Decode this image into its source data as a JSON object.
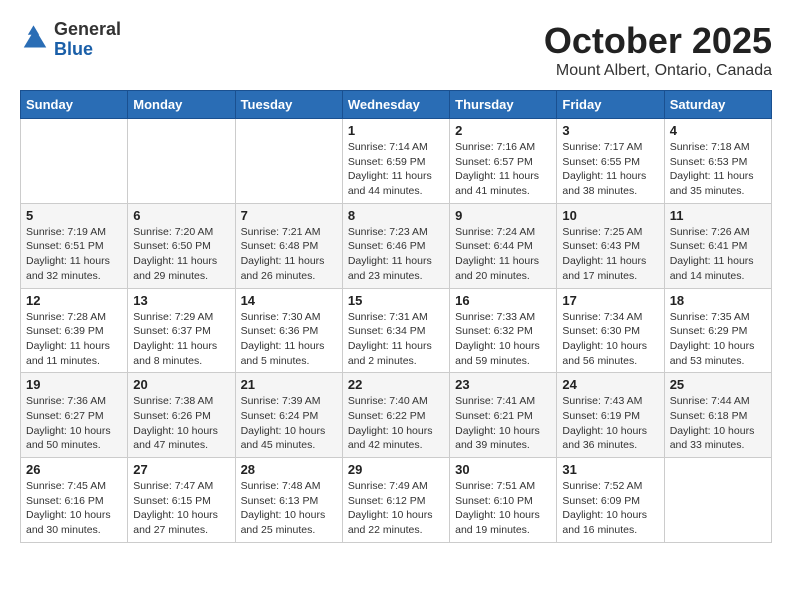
{
  "header": {
    "logo_general": "General",
    "logo_blue": "Blue",
    "month_title": "October 2025",
    "location": "Mount Albert, Ontario, Canada"
  },
  "weekdays": [
    "Sunday",
    "Monday",
    "Tuesday",
    "Wednesday",
    "Thursday",
    "Friday",
    "Saturday"
  ],
  "weeks": [
    [
      {
        "day": "",
        "info": ""
      },
      {
        "day": "",
        "info": ""
      },
      {
        "day": "",
        "info": ""
      },
      {
        "day": "1",
        "info": "Sunrise: 7:14 AM\nSunset: 6:59 PM\nDaylight: 11 hours and 44 minutes."
      },
      {
        "day": "2",
        "info": "Sunrise: 7:16 AM\nSunset: 6:57 PM\nDaylight: 11 hours and 41 minutes."
      },
      {
        "day": "3",
        "info": "Sunrise: 7:17 AM\nSunset: 6:55 PM\nDaylight: 11 hours and 38 minutes."
      },
      {
        "day": "4",
        "info": "Sunrise: 7:18 AM\nSunset: 6:53 PM\nDaylight: 11 hours and 35 minutes."
      }
    ],
    [
      {
        "day": "5",
        "info": "Sunrise: 7:19 AM\nSunset: 6:51 PM\nDaylight: 11 hours and 32 minutes."
      },
      {
        "day": "6",
        "info": "Sunrise: 7:20 AM\nSunset: 6:50 PM\nDaylight: 11 hours and 29 minutes."
      },
      {
        "day": "7",
        "info": "Sunrise: 7:21 AM\nSunset: 6:48 PM\nDaylight: 11 hours and 26 minutes."
      },
      {
        "day": "8",
        "info": "Sunrise: 7:23 AM\nSunset: 6:46 PM\nDaylight: 11 hours and 23 minutes."
      },
      {
        "day": "9",
        "info": "Sunrise: 7:24 AM\nSunset: 6:44 PM\nDaylight: 11 hours and 20 minutes."
      },
      {
        "day": "10",
        "info": "Sunrise: 7:25 AM\nSunset: 6:43 PM\nDaylight: 11 hours and 17 minutes."
      },
      {
        "day": "11",
        "info": "Sunrise: 7:26 AM\nSunset: 6:41 PM\nDaylight: 11 hours and 14 minutes."
      }
    ],
    [
      {
        "day": "12",
        "info": "Sunrise: 7:28 AM\nSunset: 6:39 PM\nDaylight: 11 hours and 11 minutes."
      },
      {
        "day": "13",
        "info": "Sunrise: 7:29 AM\nSunset: 6:37 PM\nDaylight: 11 hours and 8 minutes."
      },
      {
        "day": "14",
        "info": "Sunrise: 7:30 AM\nSunset: 6:36 PM\nDaylight: 11 hours and 5 minutes."
      },
      {
        "day": "15",
        "info": "Sunrise: 7:31 AM\nSunset: 6:34 PM\nDaylight: 11 hours and 2 minutes."
      },
      {
        "day": "16",
        "info": "Sunrise: 7:33 AM\nSunset: 6:32 PM\nDaylight: 10 hours and 59 minutes."
      },
      {
        "day": "17",
        "info": "Sunrise: 7:34 AM\nSunset: 6:30 PM\nDaylight: 10 hours and 56 minutes."
      },
      {
        "day": "18",
        "info": "Sunrise: 7:35 AM\nSunset: 6:29 PM\nDaylight: 10 hours and 53 minutes."
      }
    ],
    [
      {
        "day": "19",
        "info": "Sunrise: 7:36 AM\nSunset: 6:27 PM\nDaylight: 10 hours and 50 minutes."
      },
      {
        "day": "20",
        "info": "Sunrise: 7:38 AM\nSunset: 6:26 PM\nDaylight: 10 hours and 47 minutes."
      },
      {
        "day": "21",
        "info": "Sunrise: 7:39 AM\nSunset: 6:24 PM\nDaylight: 10 hours and 45 minutes."
      },
      {
        "day": "22",
        "info": "Sunrise: 7:40 AM\nSunset: 6:22 PM\nDaylight: 10 hours and 42 minutes."
      },
      {
        "day": "23",
        "info": "Sunrise: 7:41 AM\nSunset: 6:21 PM\nDaylight: 10 hours and 39 minutes."
      },
      {
        "day": "24",
        "info": "Sunrise: 7:43 AM\nSunset: 6:19 PM\nDaylight: 10 hours and 36 minutes."
      },
      {
        "day": "25",
        "info": "Sunrise: 7:44 AM\nSunset: 6:18 PM\nDaylight: 10 hours and 33 minutes."
      }
    ],
    [
      {
        "day": "26",
        "info": "Sunrise: 7:45 AM\nSunset: 6:16 PM\nDaylight: 10 hours and 30 minutes."
      },
      {
        "day": "27",
        "info": "Sunrise: 7:47 AM\nSunset: 6:15 PM\nDaylight: 10 hours and 27 minutes."
      },
      {
        "day": "28",
        "info": "Sunrise: 7:48 AM\nSunset: 6:13 PM\nDaylight: 10 hours and 25 minutes."
      },
      {
        "day": "29",
        "info": "Sunrise: 7:49 AM\nSunset: 6:12 PM\nDaylight: 10 hours and 22 minutes."
      },
      {
        "day": "30",
        "info": "Sunrise: 7:51 AM\nSunset: 6:10 PM\nDaylight: 10 hours and 19 minutes."
      },
      {
        "day": "31",
        "info": "Sunrise: 7:52 AM\nSunset: 6:09 PM\nDaylight: 10 hours and 16 minutes."
      },
      {
        "day": "",
        "info": ""
      }
    ]
  ]
}
